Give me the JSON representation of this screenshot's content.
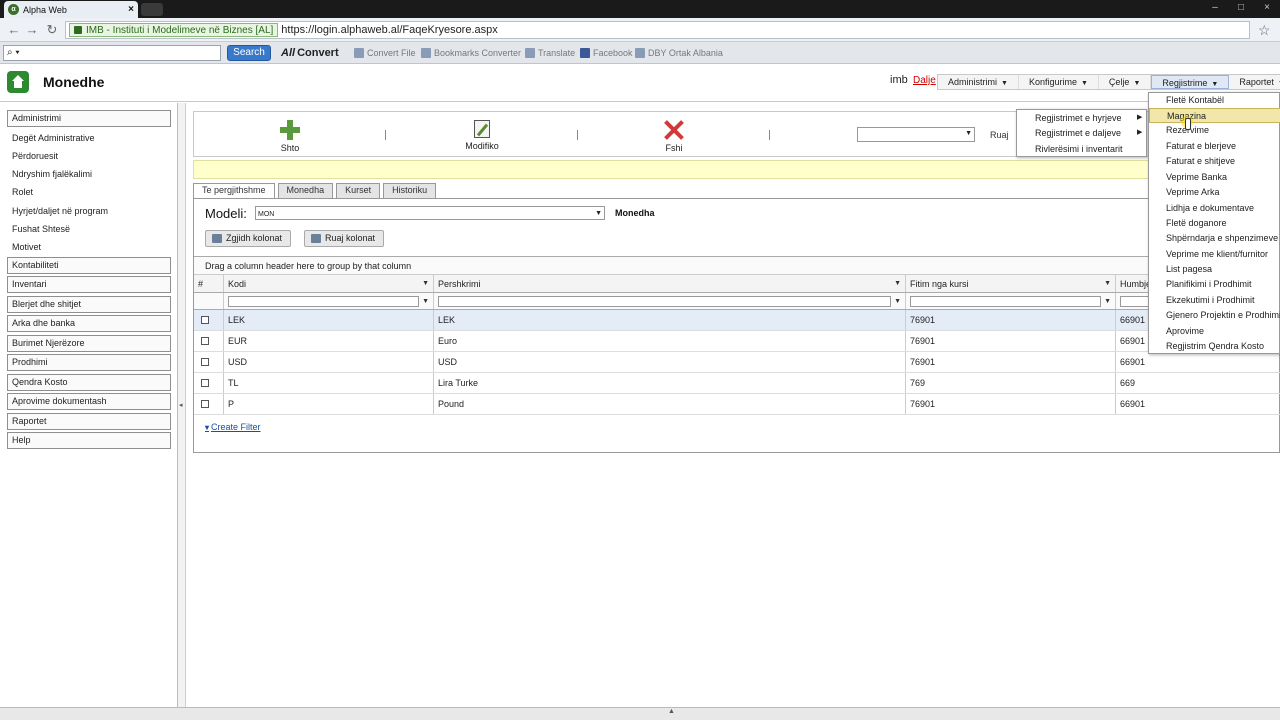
{
  "browser": {
    "tab_title": "Alpha Web",
    "tab_close": "×",
    "security_label": "IMB - Instituti i Modelimeve në Biznes [AL]",
    "url": "https://login.alphaweb.al/FaqeKryesore.aspx",
    "search_placeholder": "⌕ ▾",
    "search_button": "Search",
    "bookmarks": [
      "Convert",
      "Convert File",
      "Bookmarks Converter",
      "Translate",
      "Facebook",
      "DBY Ortak Albania"
    ],
    "bookmark_prefix": "All"
  },
  "header": {
    "page_title": "Monedhe",
    "user": "imb",
    "logout": "Dalje",
    "menu": [
      {
        "label": "Administrimi"
      },
      {
        "label": "Konfigurime"
      },
      {
        "label": "Çelje"
      },
      {
        "label": "Regjistrime"
      },
      {
        "label": "Raportet"
      }
    ]
  },
  "sidebar": {
    "sections": [
      {
        "label": "Administrimi",
        "items": [
          "Degët Administrative",
          "Përdoruesit",
          "Ndryshim fjalëkalimi",
          "Rolet",
          "Hyrjet/daljet në program",
          "Fushat Shtesë",
          "Motivet"
        ]
      },
      {
        "label": "Kontabiliteti"
      },
      {
        "label": "Inventari"
      },
      {
        "label": "Blerjet dhe shitjet"
      },
      {
        "label": "Arka dhe banka"
      },
      {
        "label": "Burimet Njerëzore"
      },
      {
        "label": "Prodhimi"
      },
      {
        "label": "Qendra Kosto"
      },
      {
        "label": "Aprovime dokumentash"
      },
      {
        "label": "Raportet"
      },
      {
        "label": "Help"
      }
    ]
  },
  "toolbar": {
    "add_label": "Shto",
    "edit_label": "Modifiko",
    "delete_label": "Fshi",
    "save_label": "Ruaj"
  },
  "tabs": [
    {
      "label": "Te pergjithshme"
    },
    {
      "label": "Monedha"
    },
    {
      "label": "Kurset"
    },
    {
      "label": "Historiku"
    }
  ],
  "panel": {
    "model_label": "Modeli:",
    "model_value": "MON",
    "model_name": "Monedha",
    "choose_columns": "Zgjidh kolonat",
    "save_columns": "Ruaj kolonat",
    "group_hint": "Drag a column header here to group by that column",
    "create_filter": "Create Filter"
  },
  "grid": {
    "columns": [
      "#",
      "Kodi",
      "Pershkrimi",
      "Fitim nga kursi",
      "Humbje"
    ],
    "rows": [
      {
        "kodi": "LEK",
        "pershkrimi": "LEK",
        "fitim": "76901",
        "humbje": "66901"
      },
      {
        "kodi": "EUR",
        "pershkrimi": "Euro",
        "fitim": "76901",
        "humbje": "66901"
      },
      {
        "kodi": "USD",
        "pershkrimi": "USD",
        "fitim": "76901",
        "humbje": "66901"
      },
      {
        "kodi": "TL",
        "pershkrimi": "Lira Turke",
        "fitim": "769",
        "humbje": "669"
      },
      {
        "kodi": "P",
        "pershkrimi": "Pound",
        "fitim": "76901",
        "humbje": "66901"
      }
    ]
  },
  "submenu_celje": [
    "Regjistrimet e hyrjeve",
    "Regjistrimet e daljeve",
    "Rivlerësimi i inventarit"
  ],
  "dropdown_regjistrime": [
    "Fletë Kontabël",
    "Magazina",
    "Rezervime",
    "Faturat e blerjeve",
    "Faturat e shitjeve",
    "Veprime Banka",
    "Veprime Arka",
    "Lidhja e dokumentave",
    "Fletë doganore",
    "Shpërndarja e shpenzimeve",
    "Veprime me klient/furnitor",
    "List pagesa",
    "Planifikimi i Prodhimit",
    "Ekzekutimi i Prodhimit",
    "Gjenero Projektin e Prodhimit",
    "Aprovime",
    "Regjistrim Qendra Kosto"
  ]
}
